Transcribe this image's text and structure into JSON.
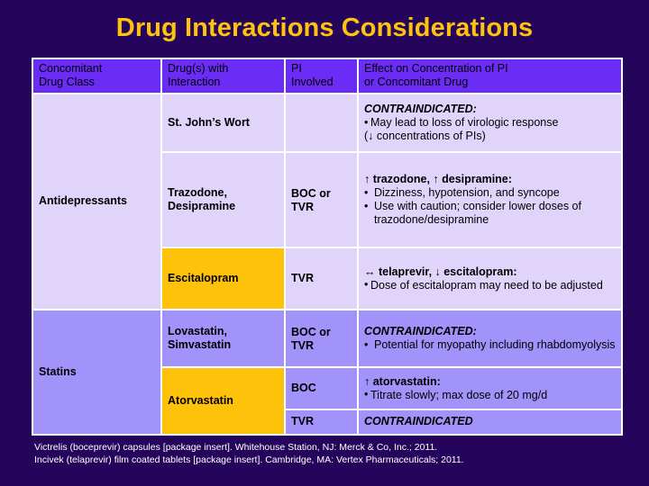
{
  "slide": {
    "title": "Drug Interactions Considerations",
    "background_color": "#25055C",
    "title_color": "#FFC20E",
    "header_color": "#6B2CF5",
    "row_tint_light": "#E0D4FA",
    "row_tint_dark": "#A193FA",
    "highlight_color": "#FFC20A"
  },
  "table": {
    "headers": [
      "Concomitant Drug Class",
      "Drug(s) with Interaction",
      "PI Involved",
      "Effect on Concentration of PI or Concomitant Drug"
    ],
    "header_lines": {
      "h1a": "Concomitant",
      "h1b": "Drug Class",
      "h2a": "Drug(s) with",
      "h2b": "Interaction",
      "h3a": "PI",
      "h3b": "Involved",
      "h4a": "Effect on Concentration of PI",
      "h4b": "or Concomitant Drug"
    },
    "groups": [
      {
        "drug_class": "Antidepressants",
        "rows": [
          {
            "drug": "St. John’s Wort",
            "pi": "",
            "effect_title": "CONTRAINDICATED:",
            "effect_title_italic": true,
            "effect_bullets": [
              "May lead to loss of virologic response"
            ],
            "effect_plain": "(↓ concentrations of PIs)"
          },
          {
            "drug": "Trazodone, Desipramine",
            "pi": "BOC or TVR",
            "effect_title": "↑ trazodone, ↑ desipramine:",
            "effect_title_italic": false,
            "effect_bullets": [
              "Dizziness, hypotension, and syncope",
              "Use with caution; consider lower doses of trazodone/desipramine"
            ],
            "effect_plain": ""
          },
          {
            "drug": "Escitalopram",
            "highlight": true,
            "pi": "TVR",
            "effect_title": "↔ telaprevir, ↓ escitalopram:",
            "effect_title_italic": false,
            "effect_bullets": [
              "Dose of escitalopram may need to be adjusted"
            ],
            "effect_plain": ""
          }
        ]
      },
      {
        "drug_class": "Statins",
        "rows": [
          {
            "drug": "Lovastatin, Simvastatin",
            "pi": "BOC or TVR",
            "effect_title": "CONTRAINDICATED:",
            "effect_title_italic": true,
            "effect_bullets": [
              "Potential for myopathy including rhabdomyolysis"
            ],
            "effect_plain": ""
          },
          {
            "drug": "Atorvastatin",
            "highlight": true,
            "pi": "BOC",
            "effect_title": "↑ atorvastatin:",
            "effect_title_italic": false,
            "effect_bullets": [
              "Titrate slowly; max dose of 20 mg/d"
            ],
            "effect_plain": ""
          },
          {
            "drug": "",
            "pi": "TVR",
            "effect_title": "CONTRAINDICATED",
            "effect_title_italic": true,
            "effect_bullets": [],
            "effect_plain": ""
          }
        ]
      }
    ]
  },
  "footnote": {
    "line1": "Victrelis (boceprevir) capsules [package insert]. Whitehouse Station, NJ: Merck & Co, Inc.; 2011.",
    "line2": "Incivek (telaprevir) film coated tablets [package insert]. Cambridge, MA: Vertex Pharmaceuticals; 2011."
  }
}
